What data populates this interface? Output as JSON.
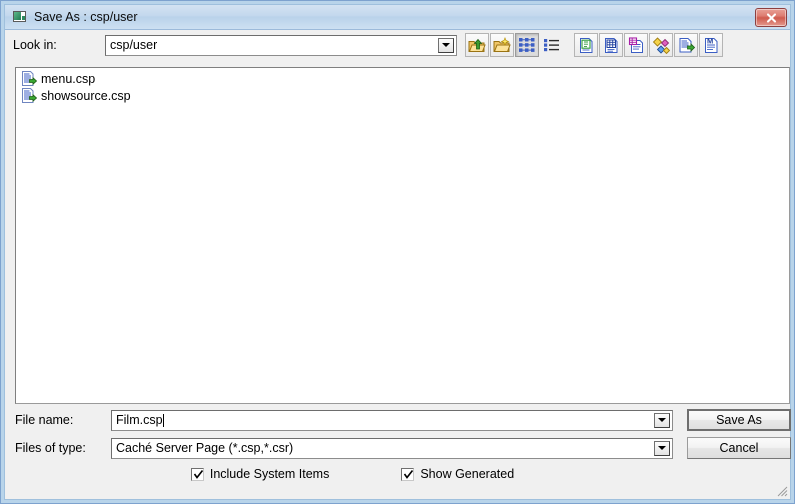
{
  "window": {
    "title": "Save As : csp/user",
    "icon": "studio-window-icon",
    "close_label": "Close"
  },
  "lookin": {
    "label": "Look in:",
    "value": "csp/user"
  },
  "toolbar": {
    "buttons": [
      {
        "name": "up-one-level-icon",
        "tooltip": "Up One Level",
        "state": "raised"
      },
      {
        "name": "new-folder-icon",
        "tooltip": "Create New Folder",
        "state": "raised"
      },
      {
        "name": "details-view-icon",
        "tooltip": "Details View",
        "state": "pressed"
      },
      {
        "name": "list-view-icon",
        "tooltip": "List View",
        "state": "raised"
      },
      {
        "name": "show-csp-files-icon",
        "tooltip": "CSP Files",
        "state": "raised"
      },
      {
        "name": "show-table-files-icon",
        "tooltip": "Table Files",
        "state": "raised"
      },
      {
        "name": "show-class-files-icon",
        "tooltip": "Class Files",
        "state": "raised"
      },
      {
        "name": "show-macro-files-icon",
        "tooltip": "Macro Files",
        "state": "raised"
      },
      {
        "name": "show-routine-files-icon",
        "tooltip": "Routine Files",
        "state": "raised"
      },
      {
        "name": "show-mac-files-icon",
        "tooltip": "MAC Files",
        "state": "raised"
      }
    ]
  },
  "filelist": {
    "items": [
      {
        "name": "menu.csp",
        "icon": "csp-document-icon"
      },
      {
        "name": "showsource.csp",
        "icon": "csp-document-icon"
      }
    ]
  },
  "form": {
    "filename_label": "File name:",
    "filename_value": "Film.csp",
    "filetype_label": "Files of type:",
    "filetype_value": "Caché Server Page (*.csp,*.csr)"
  },
  "buttons": {
    "save_as": "Save As",
    "cancel": "Cancel"
  },
  "checkboxes": [
    {
      "label": "Include System Items",
      "checked": true
    },
    {
      "label": "Show Generated",
      "checked": true
    }
  ],
  "colors": {
    "frame": "#b8d4ea",
    "titlebar": "#c3d8ed",
    "dialog_bg": "#f0f0f0",
    "close_button": "#cf5b4e",
    "list_bg": "#ffffff"
  }
}
